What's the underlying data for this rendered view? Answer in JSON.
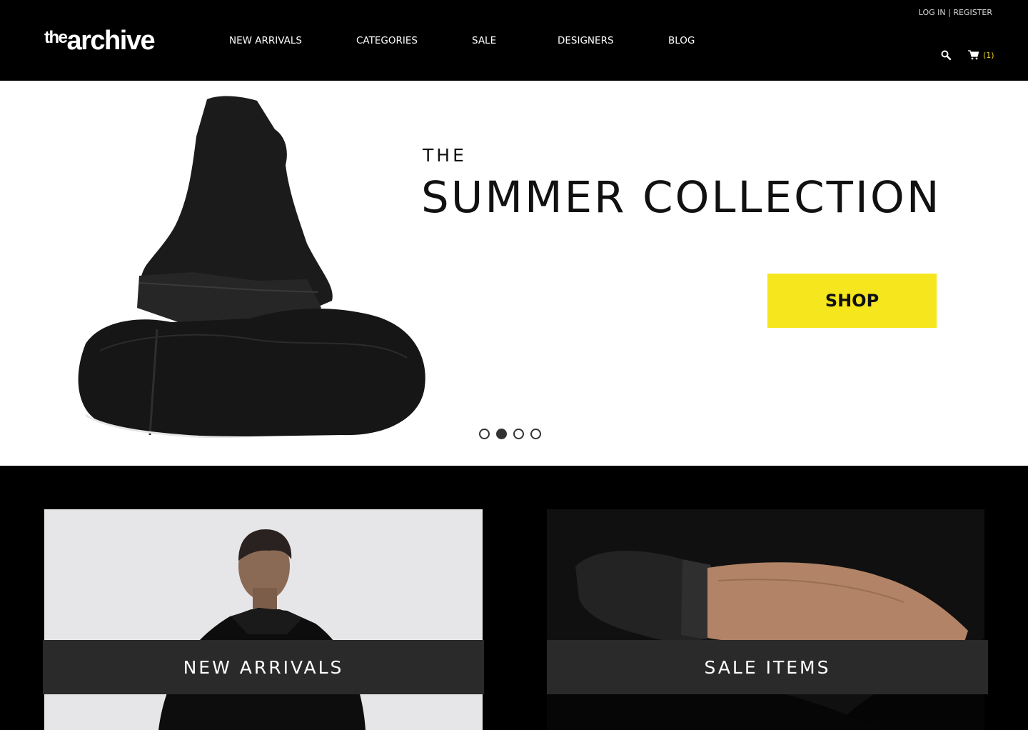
{
  "brand": {
    "logo_small": "the",
    "logo_large": "archive"
  },
  "nav": {
    "items": [
      "NEW ARRIVALS",
      "CATEGORIES",
      "SALE",
      "DESIGNERS",
      "BLOG"
    ]
  },
  "account": {
    "login": "LOG IN",
    "separator": "|",
    "register": "REGISTER"
  },
  "cart": {
    "count": "(1)",
    "count_color": "#e6d21e"
  },
  "hero": {
    "kicker": "THE",
    "title": "SUMMER COLLECTION",
    "cta_label": "SHOP",
    "cta_color": "#f5e61e",
    "slides_total": 4,
    "active_slide": 2
  },
  "tiles": {
    "left_label": "NEW ARRIVALS",
    "right_label": "SALE ITEMS"
  },
  "icons": {
    "search": "search-icon",
    "cart": "cart-icon"
  }
}
